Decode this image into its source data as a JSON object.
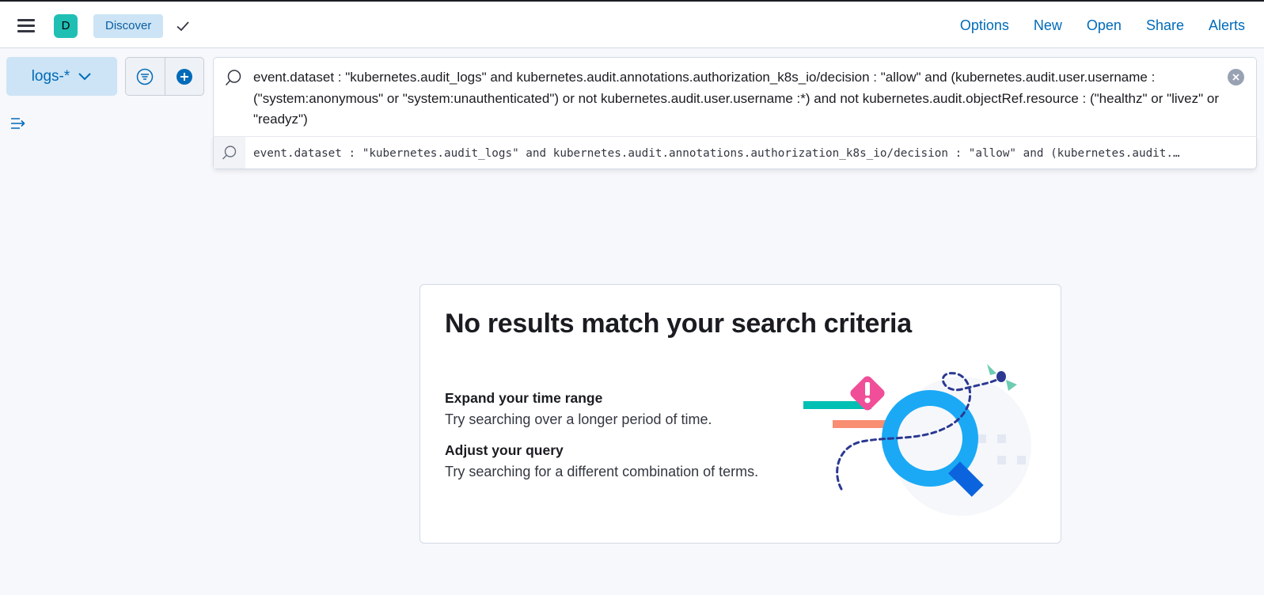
{
  "header": {
    "avatar_initial": "D",
    "breadcrumb": "Discover",
    "links": [
      "Options",
      "New",
      "Open",
      "Share",
      "Alerts"
    ]
  },
  "toolbar": {
    "index_pattern": "logs-*"
  },
  "query": {
    "text": "event.dataset : \"kubernetes.audit_logs\" and kubernetes.audit.annotations.authorization_k8s_io/decision : \"allow\" and (kubernetes.audit.user.username : (\"system:anonymous\" or \"system:unauthenticated\") or not kubernetes.audit.user.username :*) and not kubernetes.audit.objectRef.resource : (\"healthz\" or \"livez\" or \"readyz\")",
    "suggestion": "event.dataset : \"kubernetes.audit_logs\" and kubernetes.audit.annotations.authorization_k8s_io/decision : \"allow\" and (kubernetes.audit.…"
  },
  "empty_state": {
    "title": "No results match your search criteria",
    "tip1_heading": "Expand your time range",
    "tip1_text": "Try searching over a longer period of time.",
    "tip2_heading": "Adjust your query",
    "tip2_text": "Try searching for a different combination of terms."
  },
  "colors": {
    "link": "#006bb8",
    "avatar_bg": "#20bfb4",
    "crumb_bg": "#cce4f5",
    "index_btn_bg": "#cce4f5",
    "accent_blue": "#1ba9f5",
    "accent_pink": "#f04e98",
    "accent_teal": "#00bfb3",
    "accent_salmon": "#f88e72",
    "accent_navy": "#2b3992"
  }
}
